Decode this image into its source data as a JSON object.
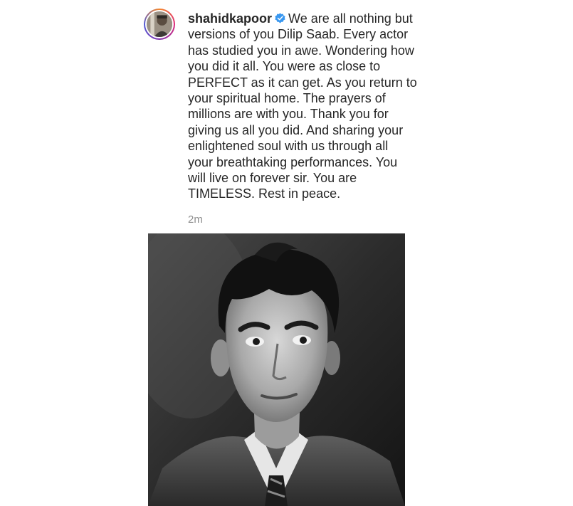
{
  "post": {
    "username": "shahidkapoor",
    "verified_icon": "verified-badge-icon",
    "caption_lines": [
      "We are all nothing but",
      "versions of you Dilip Saab. Every actor",
      "has studied you in awe. Wondering how",
      "you did it all. You were as close to",
      "PERFECT as it can get. As you return to",
      "your spiritual home. The prayers of",
      "millions are with you. Thank you for",
      "giving us all you did. And sharing your",
      "enlightened soul with us through all",
      "your breathtaking performances. You",
      "will live on forever sir. You are",
      "TIMELESS. Rest in peace."
    ],
    "timestamp": "2m"
  },
  "colors": {
    "text": "#262626",
    "muted": "#8e8e8e",
    "verified": "#3897f0"
  }
}
